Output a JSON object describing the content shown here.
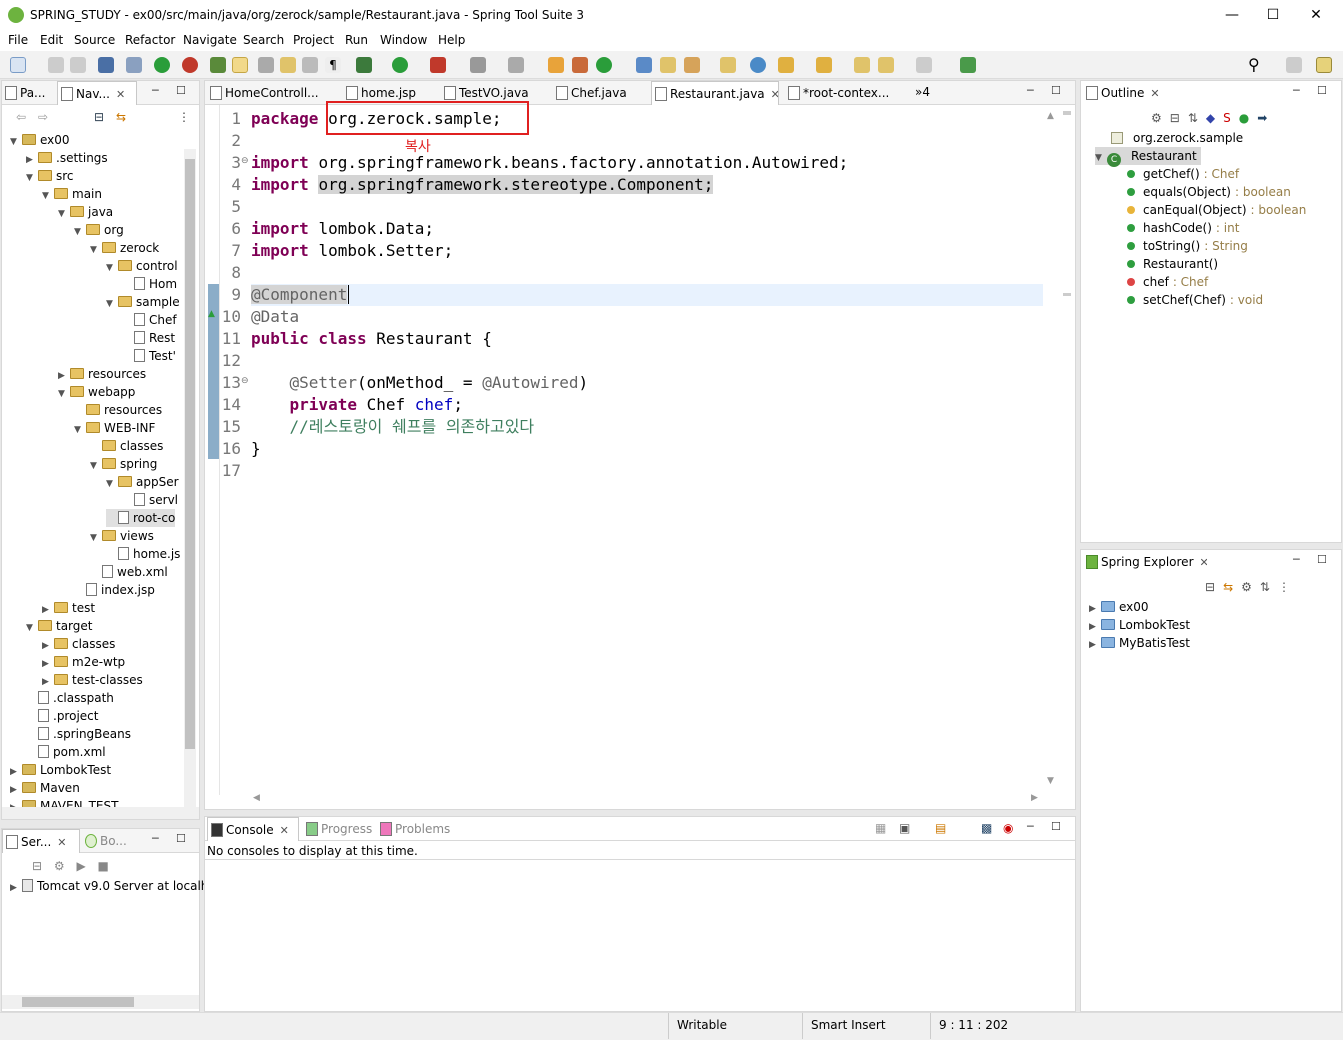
{
  "window": {
    "title": "SPRING_STUDY - ex00/src/main/java/org/zerock/sample/Restaurant.java - Spring Tool Suite 3"
  },
  "menu": [
    "File",
    "Edit",
    "Source",
    "Refactor",
    "Navigate",
    "Search",
    "Project",
    "Run",
    "Window",
    "Help"
  ],
  "left_panel": {
    "tabs": [
      "Pa...",
      "Nav..."
    ],
    "tree": [
      {
        "label": "ex00",
        "depth": 0,
        "exp": "v",
        "icon": "project"
      },
      {
        "label": ".settings",
        "depth": 1,
        "exp": ">",
        "icon": "folder"
      },
      {
        "label": "src",
        "depth": 1,
        "exp": "v",
        "icon": "folder"
      },
      {
        "label": "main",
        "depth": 2,
        "exp": "v",
        "icon": "folder"
      },
      {
        "label": "java",
        "depth": 3,
        "exp": "v",
        "icon": "folder"
      },
      {
        "label": "org",
        "depth": 4,
        "exp": "v",
        "icon": "folder"
      },
      {
        "label": "zerock",
        "depth": 5,
        "exp": "v",
        "icon": "folder"
      },
      {
        "label": "control",
        "depth": 6,
        "exp": "v",
        "icon": "folder"
      },
      {
        "label": "Hom",
        "depth": 7,
        "exp": "",
        "icon": "file"
      },
      {
        "label": "sample",
        "depth": 6,
        "exp": "v",
        "icon": "folder"
      },
      {
        "label": "Chef",
        "depth": 7,
        "exp": "",
        "icon": "file"
      },
      {
        "label": "Rest",
        "depth": 7,
        "exp": "",
        "icon": "file"
      },
      {
        "label": "Test'",
        "depth": 7,
        "exp": "",
        "icon": "file"
      },
      {
        "label": "resources",
        "depth": 3,
        "exp": ">",
        "icon": "folder"
      },
      {
        "label": "webapp",
        "depth": 3,
        "exp": "v",
        "icon": "folder"
      },
      {
        "label": "resources",
        "depth": 4,
        "exp": "",
        "icon": "folder"
      },
      {
        "label": "WEB-INF",
        "depth": 4,
        "exp": "v",
        "icon": "folder"
      },
      {
        "label": "classes",
        "depth": 5,
        "exp": "",
        "icon": "folder"
      },
      {
        "label": "spring",
        "depth": 5,
        "exp": "v",
        "icon": "folder"
      },
      {
        "label": "appSer",
        "depth": 6,
        "exp": "v",
        "icon": "folder"
      },
      {
        "label": "servl",
        "depth": 7,
        "exp": "",
        "icon": "file"
      },
      {
        "label": "root-co",
        "depth": 6,
        "exp": "",
        "icon": "file"
      },
      {
        "label": "views",
        "depth": 5,
        "exp": "v",
        "icon": "folder"
      },
      {
        "label": "home.js",
        "depth": 6,
        "exp": "",
        "icon": "file"
      },
      {
        "label": "web.xml",
        "depth": 5,
        "exp": "",
        "icon": "file"
      },
      {
        "label": "index.jsp",
        "depth": 4,
        "exp": "",
        "icon": "file"
      },
      {
        "label": "test",
        "depth": 2,
        "exp": ">",
        "icon": "folder"
      },
      {
        "label": "target",
        "depth": 1,
        "exp": "v",
        "icon": "folder"
      },
      {
        "label": "classes",
        "depth": 2,
        "exp": ">",
        "icon": "folder"
      },
      {
        "label": "m2e-wtp",
        "depth": 2,
        "exp": ">",
        "icon": "folder"
      },
      {
        "label": "test-classes",
        "depth": 2,
        "exp": ">",
        "icon": "folder"
      },
      {
        "label": ".classpath",
        "depth": 1,
        "exp": "",
        "icon": "file"
      },
      {
        "label": ".project",
        "depth": 1,
        "exp": "",
        "icon": "file"
      },
      {
        "label": ".springBeans",
        "depth": 1,
        "exp": "",
        "icon": "file"
      },
      {
        "label": "pom.xml",
        "depth": 1,
        "exp": "",
        "icon": "file"
      },
      {
        "label": "LombokTest",
        "depth": 0,
        "exp": ">",
        "icon": "project"
      },
      {
        "label": "Maven",
        "depth": 0,
        "exp": ">",
        "icon": "project"
      },
      {
        "label": "MAVEN_TEST",
        "depth": 0,
        "exp": ">",
        "icon": "project"
      }
    ]
  },
  "servers_panel": {
    "tabs": [
      "Ser...",
      "Bo..."
    ],
    "items": [
      "Tomcat v9.0 Server at localh"
    ]
  },
  "editor": {
    "tabs": [
      "HomeControll...",
      "home.jsp",
      "TestVO.java",
      "Chef.java",
      "Restaurant.java",
      "*root-contex..."
    ],
    "overflow": "»4",
    "highlight_label": "복사",
    "line_numbers": [
      "1",
      "2",
      "3",
      "4",
      "5",
      "6",
      "7",
      "8",
      "9",
      "10",
      "11",
      "12",
      "13",
      "14",
      "15",
      "16",
      "17"
    ],
    "lines": {
      "l1_kw": "package",
      "l1_rest": "org.zerock.sample;",
      "l3_kw": "import",
      "l3_rest": "org.springframework.beans.factory.annotation.Autowired;",
      "l4_kw": "import",
      "l4_rest": "org.springframework.stereotype.Component;",
      "l6_kw": "import",
      "l6_rest": "lombok.Data;",
      "l7_kw": "import",
      "l7_rest": "lombok.Setter;",
      "l9": "@Component",
      "l10": "@Data",
      "l11_kw": "public class",
      "l11_rest": "Restaurant {",
      "l13_ann": "@Setter",
      "l13_mid": "(onMethod_ = ",
      "l13_ann2": "@Autowired",
      ")": ")",
      "l14_kw": "private",
      "l14_type": "Chef",
      "l14_fld": "chef",
      ";": ";",
      "l15": "//레스토랑이 쉐프를 의존하고있다",
      "l16": "}"
    }
  },
  "console": {
    "tabs": [
      "Console",
      "Progress",
      "Problems"
    ],
    "message": "No consoles to display at this time."
  },
  "outline": {
    "title": "Outline",
    "package": "org.zerock.sample",
    "class": "Restaurant",
    "members": [
      {
        "name": "getChef()",
        "type": ": Chef",
        "color": "#2e9e3f"
      },
      {
        "name": "equals(Object)",
        "type": ": boolean",
        "color": "#2e9e3f"
      },
      {
        "name": "canEqual(Object)",
        "type": ": boolean",
        "color": "#e8b43a"
      },
      {
        "name": "hashCode()",
        "type": ": int",
        "color": "#2e9e3f"
      },
      {
        "name": "toString()",
        "type": ": String",
        "color": "#2e9e3f"
      },
      {
        "name": "Restaurant()",
        "type": "",
        "color": "#2e9e3f"
      },
      {
        "name": "chef",
        "type": ": Chef",
        "color": "#d44"
      },
      {
        "name": "setChef(Chef)",
        "type": ": void",
        "color": "#2e9e3f"
      }
    ]
  },
  "spring_explorer": {
    "title": "Spring Explorer",
    "items": [
      "ex00",
      "LombokTest",
      "MyBatisTest"
    ]
  },
  "status": {
    "mode": "Writable",
    "insert": "Smart Insert",
    "position": "9 : 11 : 202"
  },
  "colors": {
    "highlight_box": "#e02020",
    "keyword": "#7f0055",
    "annotation": "#646464",
    "comment": "#3f7f5f",
    "field": "#0000c0"
  }
}
